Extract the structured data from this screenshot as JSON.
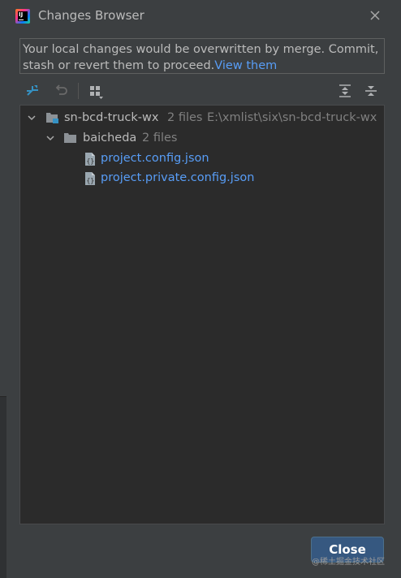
{
  "window": {
    "title": "Changes Browser"
  },
  "message": {
    "text": "Your local changes would be overwritten by merge. Commit, stash or revert them to proceed.",
    "link": "View them"
  },
  "toolbar": {
    "icons": [
      "merge-icon",
      "revert-icon",
      "group-by-icon",
      "expand-all-icon",
      "collapse-all-icon"
    ]
  },
  "tree": {
    "root": {
      "name": "sn-bcd-truck-wx",
      "count": "2 files",
      "path": "E:\\xmlist\\six\\sn-bcd-truck-wx"
    },
    "folder": {
      "name": "baicheda",
      "count": "2 files"
    },
    "files": [
      {
        "name": "project.config.json"
      },
      {
        "name": "project.private.config.json"
      }
    ]
  },
  "footer": {
    "close_label": "Close"
  },
  "watermark": "@稀土掘金技术社区",
  "colors": {
    "background": "#3c3f41",
    "tree_background": "#2b2b2b",
    "link": "#589df6",
    "button": "#365880"
  }
}
